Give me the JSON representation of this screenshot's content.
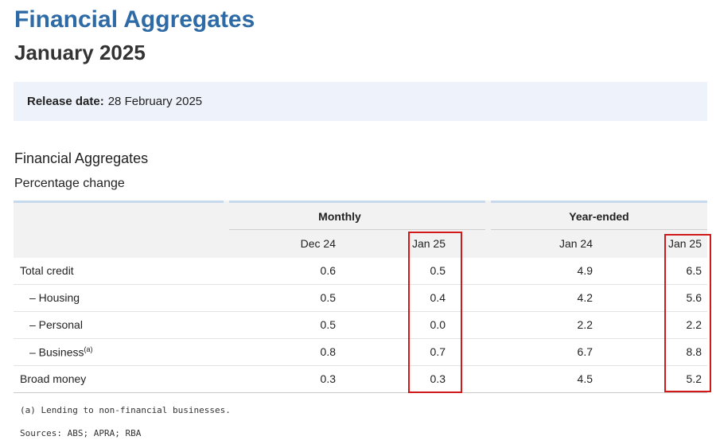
{
  "header": {
    "title": "Financial Aggregates",
    "subtitle": "January 2025"
  },
  "release": {
    "label": "Release date:",
    "value": "28 February 2025"
  },
  "section": {
    "title": "Financial Aggregates",
    "subtitle": "Percentage change"
  },
  "table": {
    "groups": {
      "monthly": "Monthly",
      "year_ended": "Year-ended"
    },
    "columns": [
      "Dec 24",
      "Jan 25",
      "Jan 24",
      "Jan 25"
    ],
    "rows": [
      {
        "label": "Total credit",
        "footnote": "",
        "values": [
          "0.6",
          "0.5",
          "4.9",
          "6.5"
        ]
      },
      {
        "label": "– Housing",
        "footnote": "",
        "values": [
          "0.5",
          "0.4",
          "4.2",
          "5.6"
        ]
      },
      {
        "label": "– Personal",
        "footnote": "",
        "values": [
          "0.5",
          "0.0",
          "2.2",
          "2.2"
        ]
      },
      {
        "label": "– Business",
        "footnote": "(a)",
        "values": [
          "0.8",
          "0.7",
          "6.7",
          "8.8"
        ]
      },
      {
        "label": "Broad money",
        "footnote": "",
        "values": [
          "0.3",
          "0.3",
          "4.5",
          "5.2"
        ]
      }
    ]
  },
  "notes": {
    "footnote": "(a) Lending to non-financial businesses.",
    "sources": "Sources: ABS; APRA; RBA"
  },
  "colors": {
    "title": "#2e6aa6",
    "release_bg": "#eef3fb",
    "highlight": "#d11919"
  }
}
